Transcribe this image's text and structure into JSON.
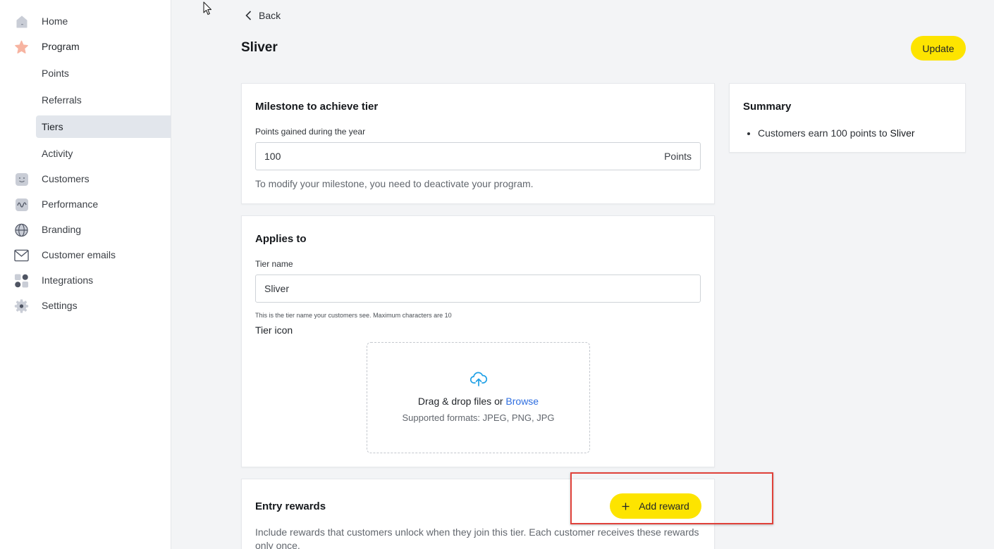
{
  "sidebar": {
    "items": [
      {
        "label": "Home",
        "icon": "home-icon"
      },
      {
        "label": "Program",
        "icon": "star-icon"
      },
      {
        "label": "Customers",
        "icon": "smiley-icon"
      },
      {
        "label": "Performance",
        "icon": "wave-chart-icon"
      },
      {
        "label": "Branding",
        "icon": "globe-icon"
      },
      {
        "label": "Customer emails",
        "icon": "envelope-icon"
      },
      {
        "label": "Integrations",
        "icon": "grid-dots-icon"
      },
      {
        "label": "Settings",
        "icon": "gear-icon"
      }
    ],
    "program_sub": [
      {
        "label": "Points"
      },
      {
        "label": "Referrals"
      },
      {
        "label": "Tiers"
      },
      {
        "label": "Activity"
      }
    ]
  },
  "header": {
    "back_label": "Back",
    "title": "Sliver",
    "update_label": "Update"
  },
  "milestone": {
    "title": "Milestone to achieve tier",
    "field_label": "Points gained during the year",
    "value": "100",
    "suffix": "Points",
    "help": "To modify your milestone, you need to deactivate your program."
  },
  "applies": {
    "title": "Applies to",
    "tier_name_label": "Tier name",
    "tier_name_value": "Sliver",
    "tier_name_help": "This is the tier name your customers see. Maximum characters are 10",
    "tier_icon_label": "Tier icon",
    "drop_text": "Drag & drop files or",
    "browse_label": "Browse",
    "formats": "Supported formats: JPEG, PNG, JPG"
  },
  "entry_rewards": {
    "title": "Entry rewards",
    "add_label": "Add reward",
    "description": "Include rewards that customers unlock when they join this tier. Each customer receives these rewards only once."
  },
  "summary": {
    "title": "Summary",
    "item_prefix": "Customers earn 100 points to",
    "item_tier": "Sliver"
  },
  "colors": {
    "accent_yellow": "#fde400",
    "link_blue": "#2e6ee0",
    "upload_icon": "#1ea0e6",
    "highlight_red": "#e0413a",
    "sidebar_active": "#e2e6ec"
  }
}
